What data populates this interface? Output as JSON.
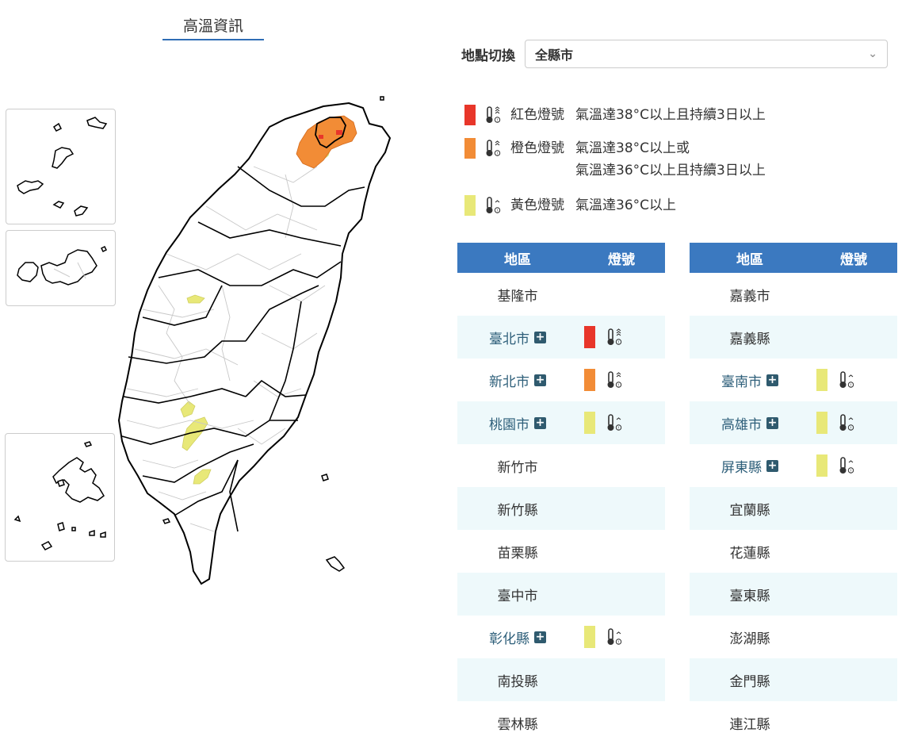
{
  "header": {
    "title": "高溫資訊"
  },
  "location": {
    "label": "地點切換",
    "selected": "全縣市"
  },
  "colors": {
    "red": "#e8362a",
    "orange": "#f28c36",
    "yellow": "#e8e878",
    "header_blue": "#3b79c0"
  },
  "legend": [
    {
      "level": "red",
      "name": "紅色燈號",
      "desc": [
        "氣溫達38°C以上且持續3日以上"
      ],
      "icon": "thermometer-triple-arrow-icon"
    },
    {
      "level": "orange",
      "name": "橙色燈號",
      "desc": [
        "氣溫達38°C以上或",
        "氣溫達36°C以上且持續3日以上"
      ],
      "icon": "thermometer-double-arrow-icon"
    },
    {
      "level": "yellow",
      "name": "黃色燈號",
      "desc": [
        "氣溫達36°C以上"
      ],
      "icon": "thermometer-single-arrow-icon"
    }
  ],
  "table": {
    "col_region": "地區",
    "col_signal": "燈號",
    "left": [
      {
        "name": "基隆市",
        "level": ""
      },
      {
        "name": "臺北市",
        "level": "red"
      },
      {
        "name": "新北市",
        "level": "orange"
      },
      {
        "name": "桃園市",
        "level": "yellow"
      },
      {
        "name": "新竹市",
        "level": ""
      },
      {
        "name": "新竹縣",
        "level": ""
      },
      {
        "name": "苗栗縣",
        "level": ""
      },
      {
        "name": "臺中市",
        "level": ""
      },
      {
        "name": "彰化縣",
        "level": "yellow"
      },
      {
        "name": "南投縣",
        "level": ""
      },
      {
        "name": "雲林縣",
        "level": ""
      }
    ],
    "right": [
      {
        "name": "嘉義市",
        "level": ""
      },
      {
        "name": "嘉義縣",
        "level": ""
      },
      {
        "name": "臺南市",
        "level": "yellow"
      },
      {
        "name": "高雄市",
        "level": "yellow"
      },
      {
        "name": "屏東縣",
        "level": "yellow"
      },
      {
        "name": "宜蘭縣",
        "level": ""
      },
      {
        "name": "花蓮縣",
        "level": ""
      },
      {
        "name": "臺東縣",
        "level": ""
      },
      {
        "name": "澎湖縣",
        "level": ""
      },
      {
        "name": "金門縣",
        "level": ""
      },
      {
        "name": "連江縣",
        "level": ""
      }
    ]
  }
}
